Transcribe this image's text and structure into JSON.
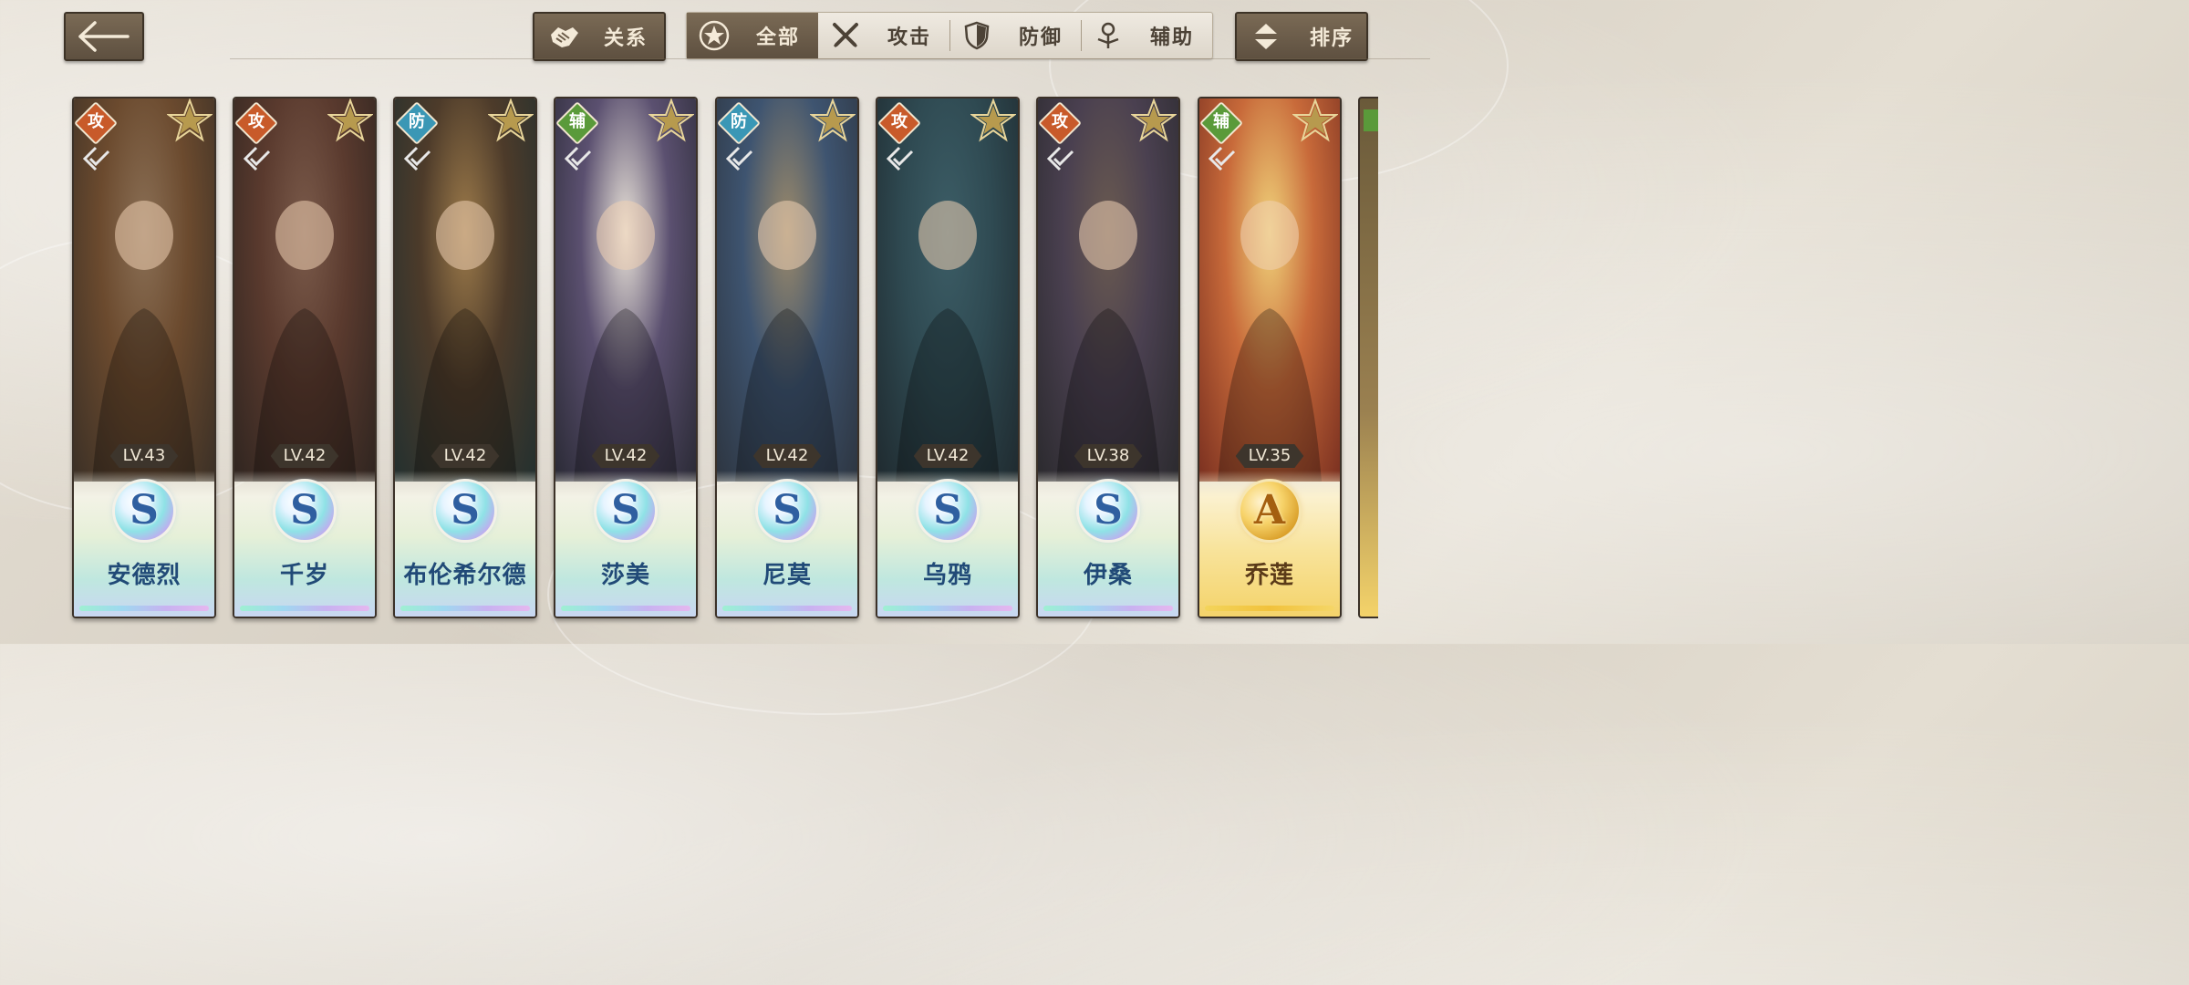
{
  "header": {
    "relation_label": "关系",
    "sort_label": "排序",
    "filters": [
      {
        "label": "全部",
        "icon": "star-badge-icon",
        "active": true
      },
      {
        "label": "攻击",
        "icon": "crossed-swords-icon",
        "active": false
      },
      {
        "label": "防御",
        "icon": "shield-icon",
        "active": false
      },
      {
        "label": "辅助",
        "icon": "support-icon",
        "active": false
      }
    ]
  },
  "colors": {
    "attack": "#c85a2a",
    "defense": "#3a97b5",
    "support": "#5a9a3a",
    "button_dark": "#6b5b48"
  },
  "characters": [
    {
      "name": "安德烈",
      "level": "LV.43",
      "role": "攻",
      "rank": "S"
    },
    {
      "name": "千岁",
      "level": "LV.42",
      "role": "攻",
      "rank": "S"
    },
    {
      "name": "布伦希尔德",
      "level": "LV.42",
      "role": "防",
      "rank": "S"
    },
    {
      "name": "莎美",
      "level": "LV.42",
      "role": "辅",
      "rank": "S"
    },
    {
      "name": "尼莫",
      "level": "LV.42",
      "role": "防",
      "rank": "S"
    },
    {
      "name": "乌鸦",
      "level": "LV.42",
      "role": "攻",
      "rank": "S"
    },
    {
      "name": "伊桑",
      "level": "LV.38",
      "role": "攻",
      "rank": "S"
    },
    {
      "name": "乔莲",
      "level": "LV.35",
      "role": "辅",
      "rank": "A"
    }
  ]
}
